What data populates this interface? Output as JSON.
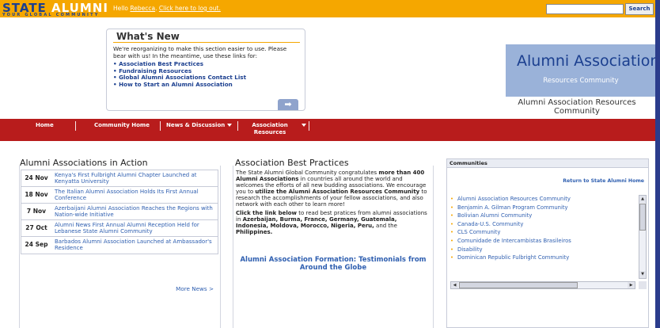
{
  "header": {
    "logo_text_a": "STATE",
    "logo_text_b": "ALUMNI",
    "logo_tagline": "YOUR GLOBAL COMMUNITY",
    "greeting": "Hello",
    "user_name": "Rebecca",
    "logout_link": "Click here to log out.",
    "search_value": "",
    "search_button": "Search",
    "brand_color": "#f5a700"
  },
  "whats_new": {
    "title": "What's New",
    "intro": "We're reorganizing to make this section easier to use.  Please bear with us!  In the meantime, use these links for:",
    "links": [
      "Association Best Practices",
      "Fundraising Resources",
      "Global Alumni Associations Contact List",
      "How to Start an Alumni Association"
    ],
    "next_arrow": "➡"
  },
  "community_logo": {
    "title": "Alumni Association",
    "subtitle": "Resources Community",
    "caption": "Alumni Association Resources Community"
  },
  "nav": {
    "items": [
      {
        "label": "Home"
      },
      {
        "label": "Community Home"
      },
      {
        "label": "News & Discussion"
      },
      {
        "label": "Association Resources"
      }
    ],
    "color": "#b81c1c"
  },
  "news": {
    "title": "Alumni Associations in Action",
    "items": [
      {
        "date": "24 Nov",
        "text": "Kenya's First Fulbright Alumni Chapter Launched at Kenyatta University"
      },
      {
        "date": "18 Nov",
        "text": "The Italian Alumni Association Holds Its First Annual Conference"
      },
      {
        "date": "7 Nov",
        "text": "Azerbaijani Alumni Association Reaches the Regions with Nation-wide Initiative"
      },
      {
        "date": "27 Oct",
        "text": "Alumni News First Annual Alumni Reception Held for Lebanese State Alumni Community"
      },
      {
        "date": "24 Sep",
        "text": "Barbados Alumni Association Launched at Ambassador's Residence"
      }
    ],
    "more": "More News >"
  },
  "best_practices": {
    "title": "Association Best Practices",
    "p1_a": "The State Alumni Global Community congratulates ",
    "p1_b": "more than 400 Alumni Associations",
    "p1_c": " in countries all around the world and welcomes the efforts of all new budding associations. We encourage you to ",
    "p1_d": "utilize the Alumni Association Resources Community",
    "p1_e": " to research the accomplishments of your fellow associations, and also network with each other to learn more!",
    "p2_a": "Click the link below",
    "p2_b": " to read best pratices from alumni associations in ",
    "p2_c": "Azerbaijan, Burma, France, Germany, Guatemala, Indonesia, Moldova, Morocco, Nigeria, Peru,",
    "p2_d": " and the ",
    "p2_e": "Philippines.",
    "link": "Alumni Association Formation: Testimonials from Around the Globe"
  },
  "communities": {
    "title": "Communities",
    "return_link": "Return to State Alumni Home",
    "items": [
      "Alumni Association Resources Community",
      "Benjamin A. Gilman Program Community",
      "Bolivian Alumni Community",
      "Canada-U.S. Community",
      "CLS Community",
      "Comunidade de Intercambistas Brasileiros",
      "Disability",
      "Dominican Republic Fulbright Community"
    ],
    "scroll_up": "▲",
    "scroll_down": "▼",
    "scroll_left": "◀",
    "scroll_right": "▶"
  }
}
